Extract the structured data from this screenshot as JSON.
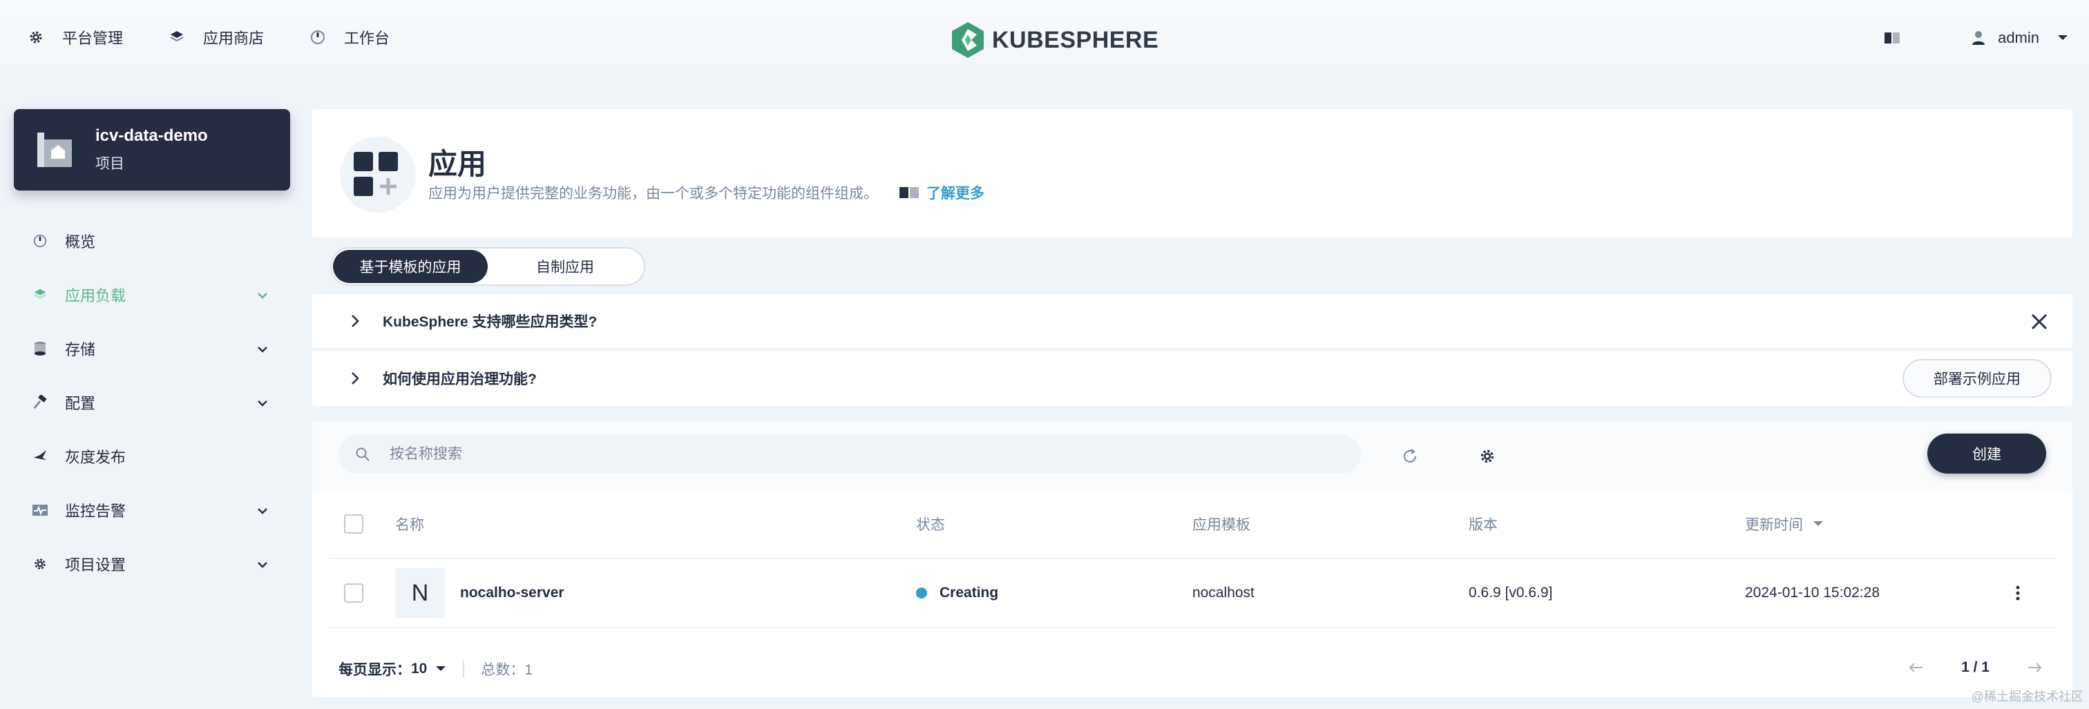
{
  "topnav": {
    "items": [
      {
        "label": "平台管理",
        "icon": "gear-icon"
      },
      {
        "label": "应用商店",
        "icon": "layers-icon"
      },
      {
        "label": "工作台",
        "icon": "dashboard-icon"
      }
    ],
    "brand": "KUBESPHERE",
    "user": "admin"
  },
  "project": {
    "name": "icv-data-demo",
    "type": "项目"
  },
  "sidebar": {
    "items": [
      {
        "label": "概览",
        "icon": "dashboard-icon",
        "expandable": false
      },
      {
        "label": "应用负载",
        "icon": "layers-icon",
        "expandable": true,
        "active": true
      },
      {
        "label": "存储",
        "icon": "database-icon",
        "expandable": true
      },
      {
        "label": "配置",
        "icon": "hammer-icon",
        "expandable": true
      },
      {
        "label": "灰度发布",
        "icon": "bird-icon",
        "expandable": false
      },
      {
        "label": "监控告警",
        "icon": "monitor-icon",
        "expandable": true
      },
      {
        "label": "项目设置",
        "icon": "gear-icon",
        "expandable": true
      }
    ]
  },
  "banner": {
    "title": "应用",
    "description": "应用为用户提供完整的业务功能，由一个或多个特定功能的组件组成。",
    "learn_more": "了解更多"
  },
  "tabs": [
    "基于模板的应用",
    "自制应用"
  ],
  "faq": {
    "q1": "KubeSphere 支持哪些应用类型?",
    "q2": "如何使用应用治理功能?",
    "sample_button": "部署示例应用"
  },
  "toolbar": {
    "search_placeholder": "按名称搜索",
    "create_label": "创建"
  },
  "table": {
    "columns": [
      "名称",
      "状态",
      "应用模板",
      "版本",
      "更新时间"
    ],
    "rows": [
      {
        "avatar": "N",
        "name": "nocalho-server",
        "status": "Creating",
        "template": "nocalhost",
        "version": "0.6.9 [v0.6.9]",
        "updated": "2024-01-10 15:02:28"
      }
    ]
  },
  "pagination": {
    "page_size_label": "每页显示：",
    "page_size": "10",
    "total_label": "总数：",
    "total": "1",
    "page_info": "1 / 1"
  },
  "watermark": "@稀土掘金技术社区",
  "colors": {
    "accent": "#55bc8a",
    "dark": "#242e42",
    "link": "#329dce",
    "status_creating": "#329dce"
  }
}
